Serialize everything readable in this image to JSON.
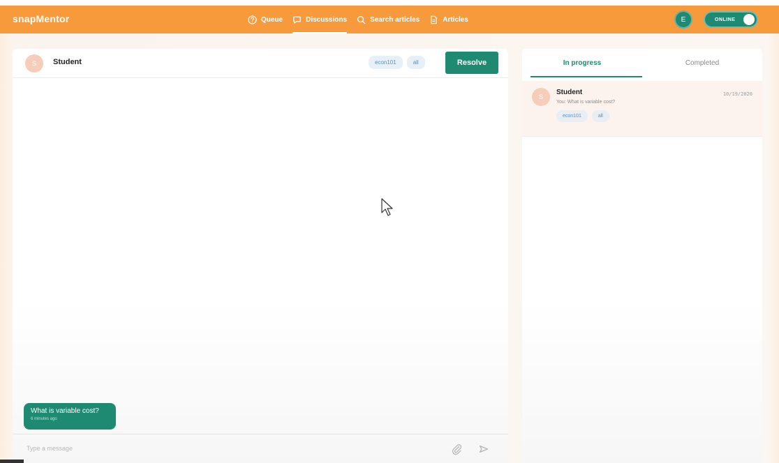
{
  "app": {
    "logo": "snapMentor",
    "nav": [
      {
        "label": "Queue",
        "icon": "help-circle-icon"
      },
      {
        "label": "Discussions",
        "icon": "chat-bubble-icon"
      },
      {
        "label": "Search articles",
        "icon": "search-icon"
      },
      {
        "label": "Articles",
        "icon": "document-icon"
      }
    ],
    "user_initial": "E",
    "status_label": "ONLINE"
  },
  "chat": {
    "avatar_initial": "S",
    "name": "Student",
    "tags": [
      "econ101",
      "all"
    ],
    "resolve_label": "Resolve",
    "messages": [
      {
        "text": "What is variable cost?",
        "time": "6 minutes ago"
      }
    ],
    "input_placeholder": "Type a message"
  },
  "sidebar": {
    "tabs": [
      {
        "label": "In progress",
        "active": true
      },
      {
        "label": "Completed",
        "active": false
      }
    ],
    "conversations": [
      {
        "avatar_initial": "S",
        "name": "Student",
        "date": "10/19/2020",
        "preview": "You: What is variable cost?",
        "tags": [
          "econ101",
          "all"
        ]
      }
    ]
  },
  "colors": {
    "brand_orange": "#f79a3c",
    "brand_teal": "#1f8a72"
  }
}
